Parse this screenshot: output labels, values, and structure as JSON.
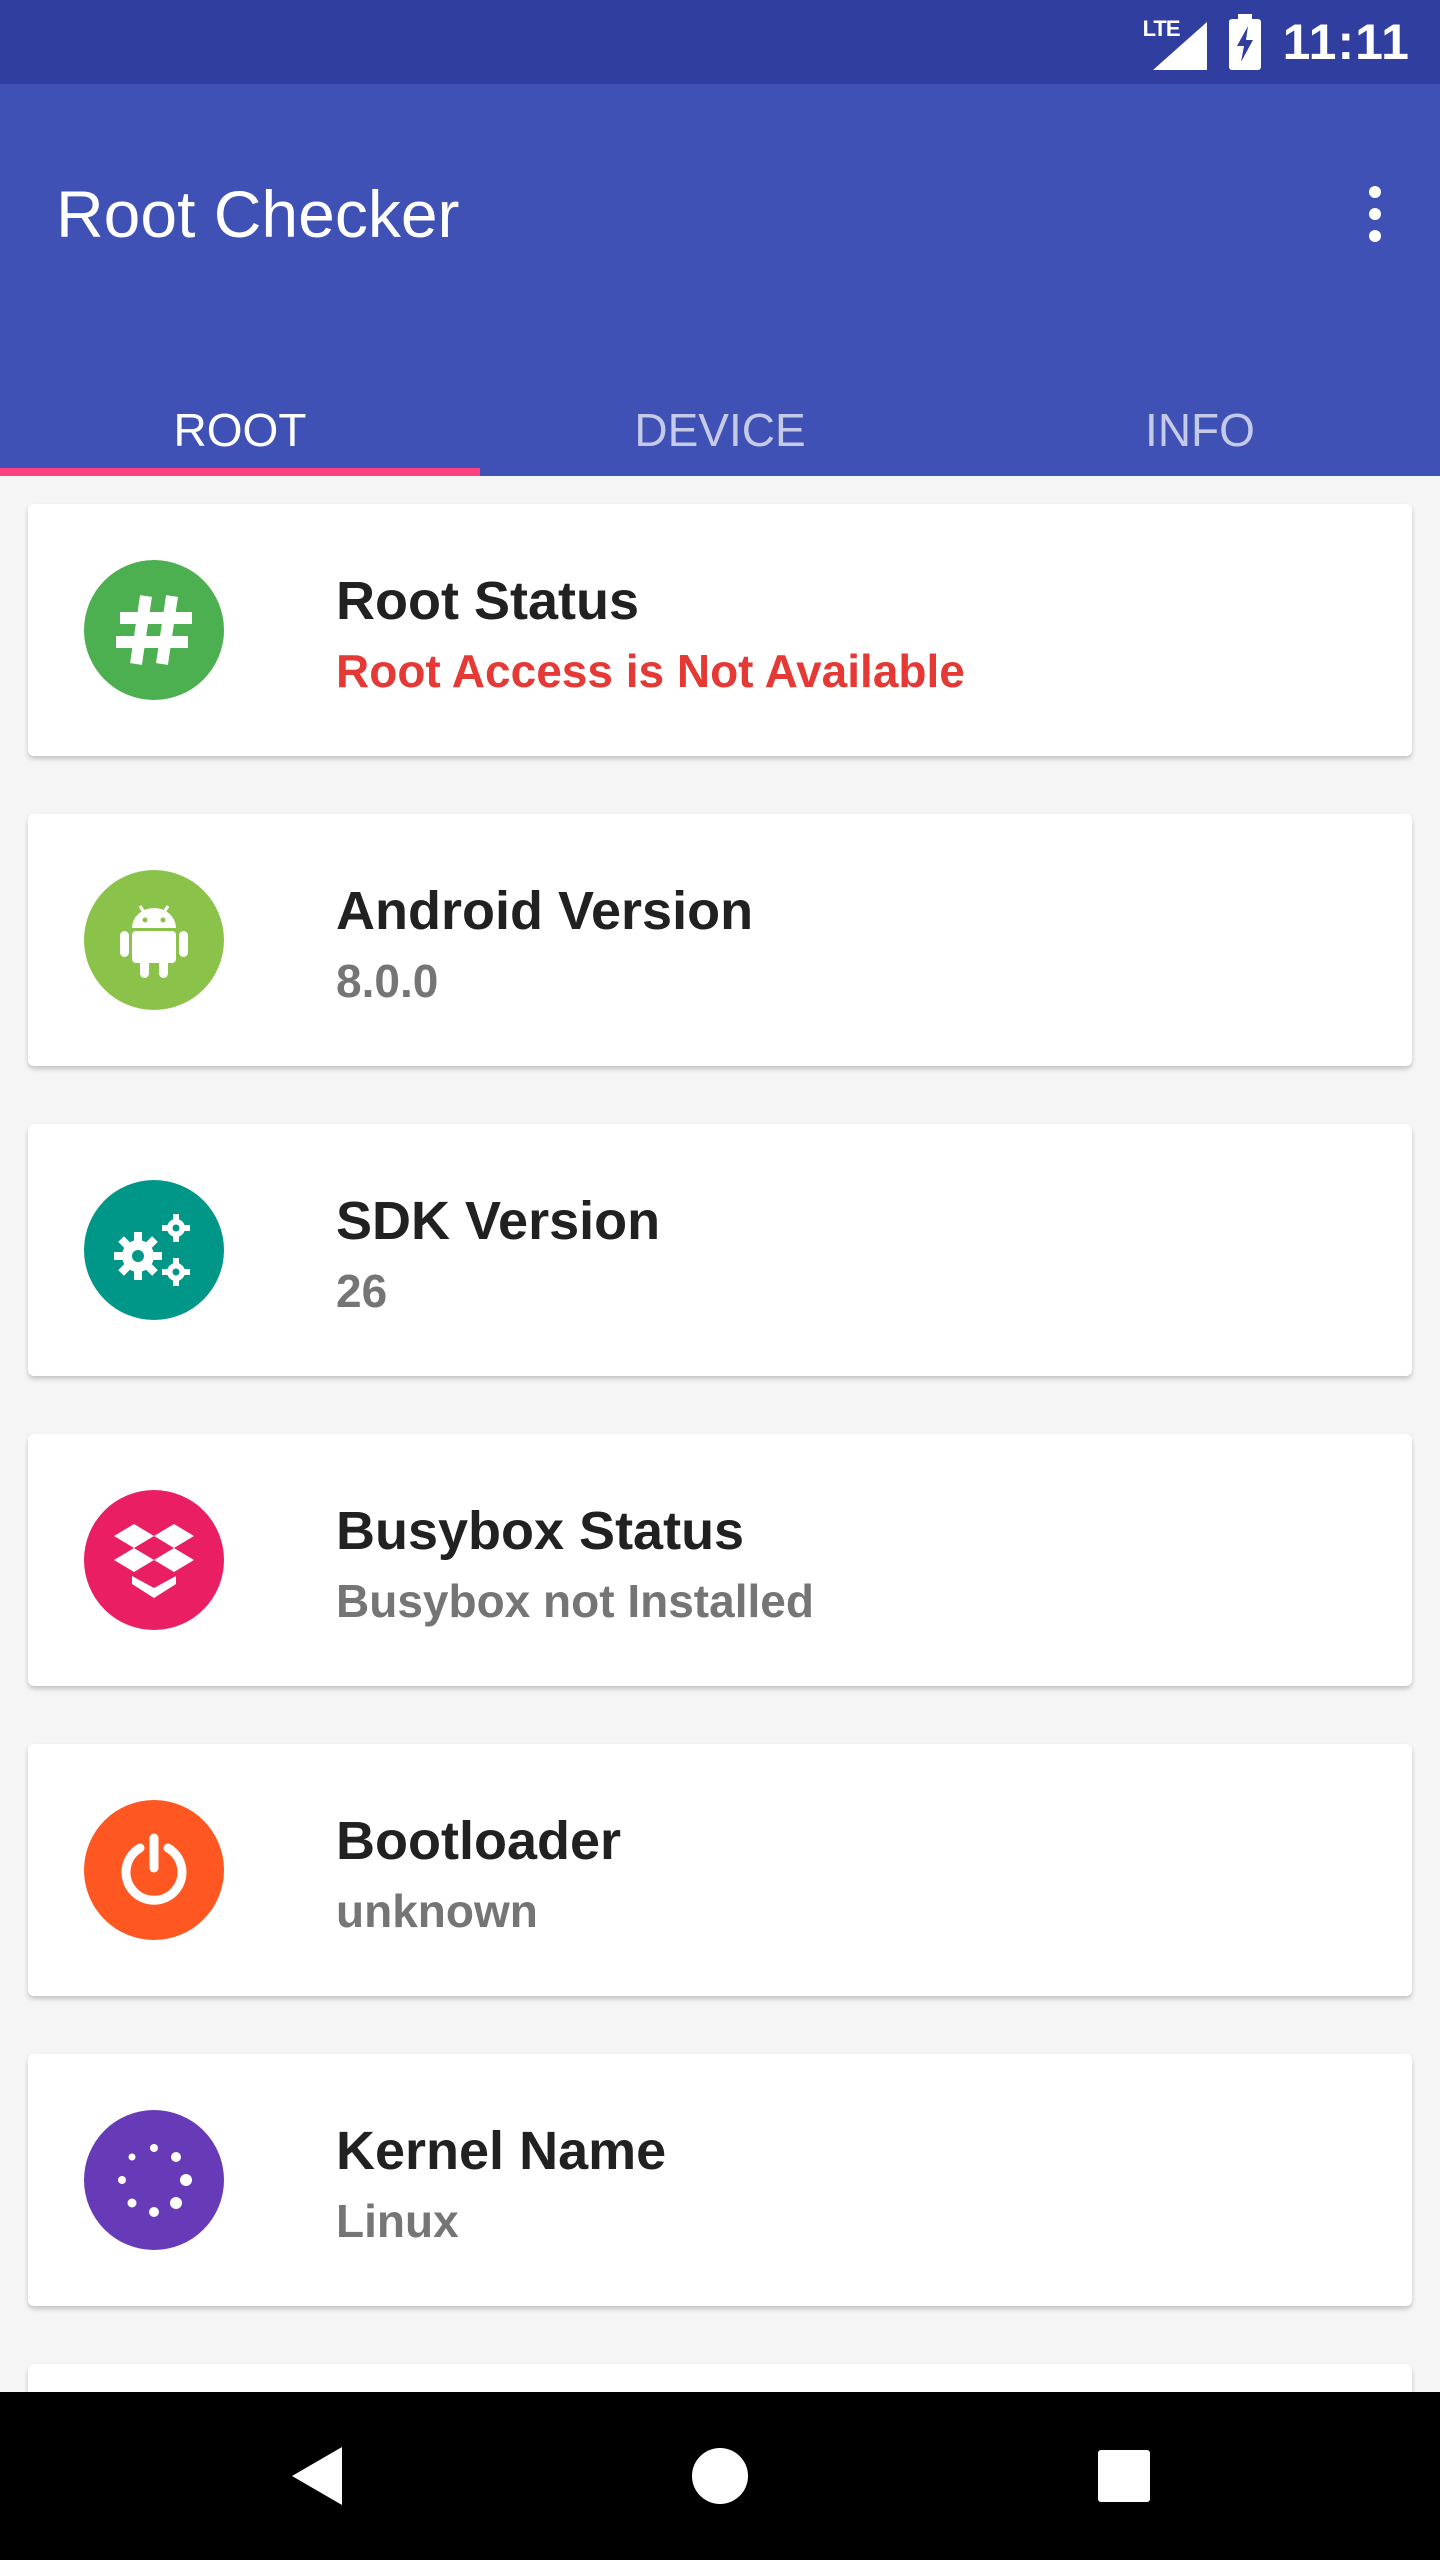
{
  "status_bar": {
    "network": "LTE",
    "time": "11:11"
  },
  "app_bar": {
    "title": "Root Checker",
    "menu_icon": "more-vert-icon"
  },
  "tabs": [
    {
      "label": "ROOT",
      "active": true
    },
    {
      "label": "DEVICE",
      "active": false
    },
    {
      "label": "INFO",
      "active": false
    }
  ],
  "cards": [
    {
      "title": "Root Status",
      "value": "Root Access is Not Available",
      "icon": "hash-icon",
      "icon_color": "#4caf50",
      "value_color": "#e53935"
    },
    {
      "title": "Android Version",
      "value": "8.0.0",
      "icon": "android-icon",
      "icon_color": "#8bc34a"
    },
    {
      "title": "SDK Version",
      "value": "26",
      "icon": "gears-icon",
      "icon_color": "#009688"
    },
    {
      "title": "Busybox Status",
      "value": "Busybox not Installed",
      "icon": "box-icon",
      "icon_color": "#e91e63"
    },
    {
      "title": "Bootloader",
      "value": "unknown",
      "icon": "power-icon",
      "icon_color": "#ff5722"
    },
    {
      "title": "Kernel Name",
      "value": "Linux",
      "icon": "spinner-icon",
      "icon_color": "#673ab7"
    }
  ],
  "nav_bar": {
    "back": "back-icon",
    "home": "home-icon",
    "recents": "recents-icon"
  }
}
